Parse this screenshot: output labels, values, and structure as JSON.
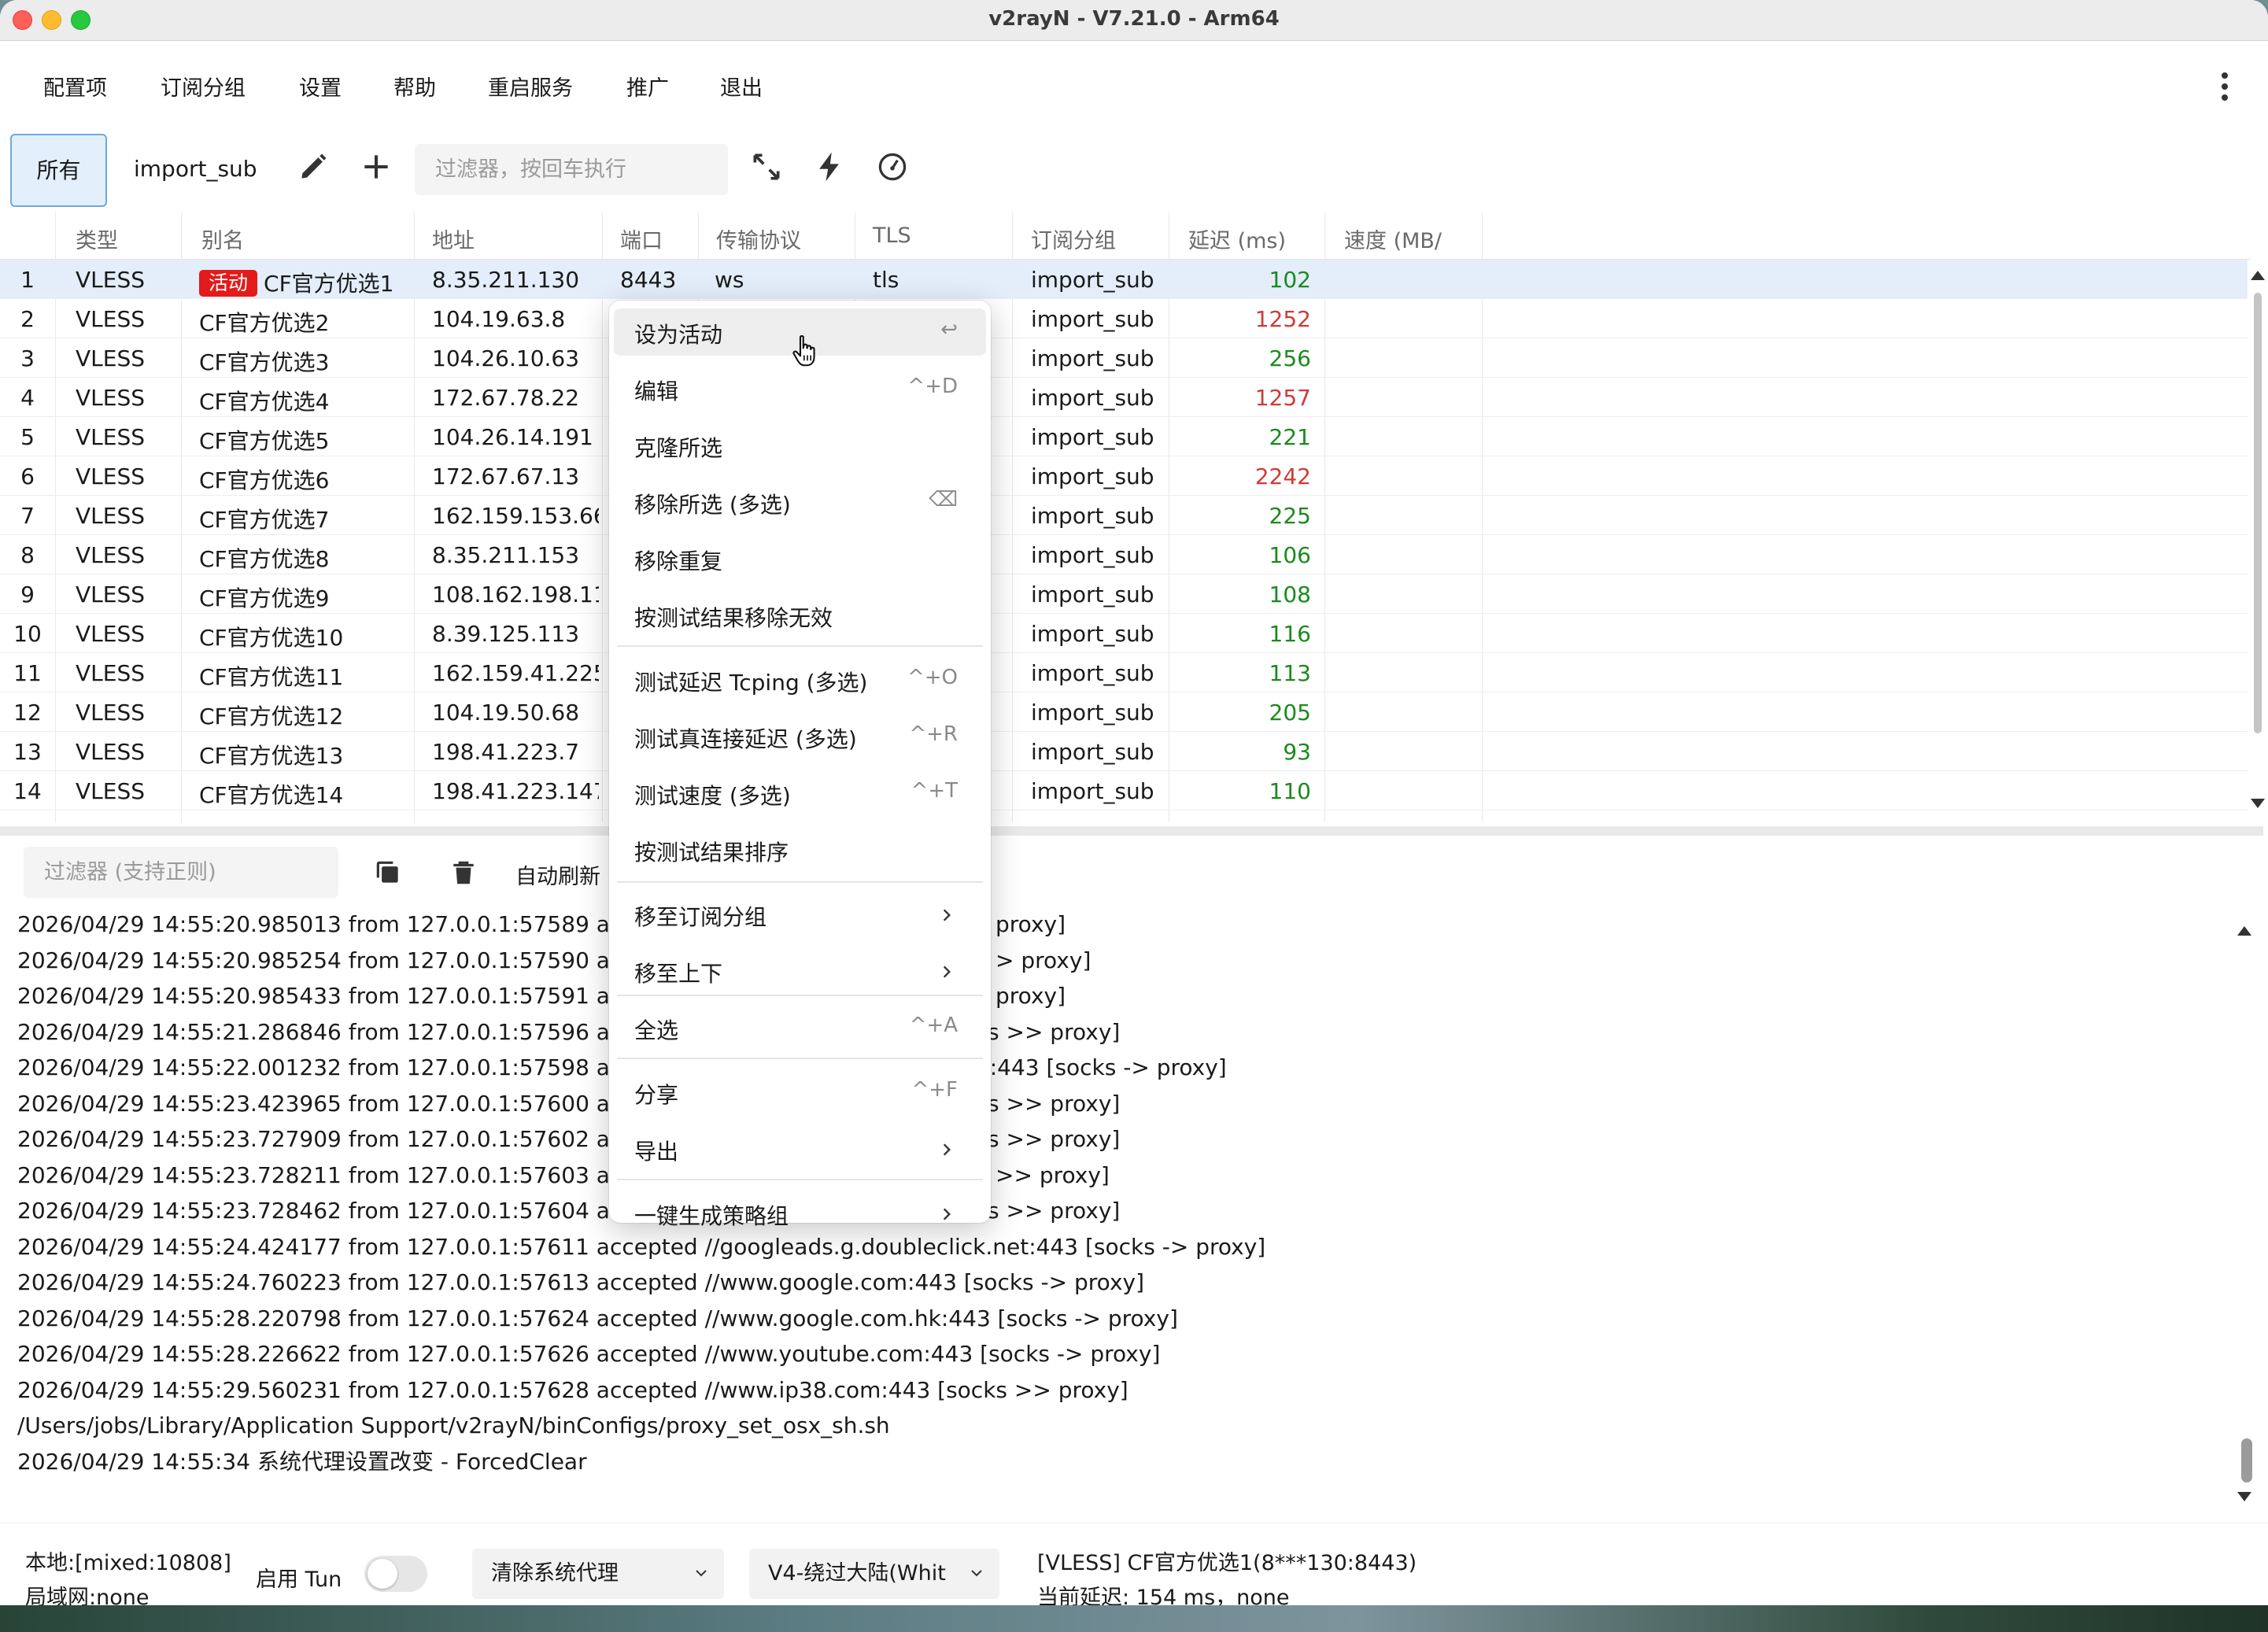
{
  "window": {
    "title": "v2rayN - V7.21.0 - Arm64"
  },
  "menu": {
    "items": [
      "配置项",
      "订阅分组",
      "设置",
      "帮助",
      "重启服务",
      "推广",
      "退出"
    ]
  },
  "toolbar": {
    "tab_all": "所有",
    "tab_sub": "import_sub",
    "filter_placeholder": "过滤器，按回车执行"
  },
  "table": {
    "headers": [
      "类型",
      "别名",
      "地址",
      "端口",
      "传输协议",
      "TLS",
      "订阅分组",
      "延迟 (ms)",
      "速度 (MB/"
    ],
    "active_badge": "活动",
    "rows": [
      {
        "idx": "1",
        "type": "VLESS",
        "alias": "CF官方优选1",
        "addr": "8.35.211.130",
        "port": "8443",
        "proto": "ws",
        "tls": "tls",
        "sub": "import_sub",
        "delay": "102",
        "status": "good"
      },
      {
        "idx": "2",
        "type": "VLESS",
        "alias": "CF官方优选2",
        "addr": "104.19.63.8",
        "port": "",
        "proto": "",
        "tls": "",
        "sub": "import_sub",
        "delay": "1252",
        "status": "bad"
      },
      {
        "idx": "3",
        "type": "VLESS",
        "alias": "CF官方优选3",
        "addr": "104.26.10.63",
        "port": "",
        "proto": "",
        "tls": "",
        "sub": "import_sub",
        "delay": "256",
        "status": "good"
      },
      {
        "idx": "4",
        "type": "VLESS",
        "alias": "CF官方优选4",
        "addr": "172.67.78.22",
        "port": "",
        "proto": "",
        "tls": "",
        "sub": "import_sub",
        "delay": "1257",
        "status": "bad"
      },
      {
        "idx": "5",
        "type": "VLESS",
        "alias": "CF官方优选5",
        "addr": "104.26.14.191",
        "port": "",
        "proto": "",
        "tls": "",
        "sub": "import_sub",
        "delay": "221",
        "status": "good"
      },
      {
        "idx": "6",
        "type": "VLESS",
        "alias": "CF官方优选6",
        "addr": "172.67.67.13",
        "port": "",
        "proto": "",
        "tls": "",
        "sub": "import_sub",
        "delay": "2242",
        "status": "bad"
      },
      {
        "idx": "7",
        "type": "VLESS",
        "alias": "CF官方优选7",
        "addr": "162.159.153.66",
        "port": "",
        "proto": "",
        "tls": "",
        "sub": "import_sub",
        "delay": "225",
        "status": "good"
      },
      {
        "idx": "8",
        "type": "VLESS",
        "alias": "CF官方优选8",
        "addr": "8.35.211.153",
        "port": "",
        "proto": "",
        "tls": "",
        "sub": "import_sub",
        "delay": "106",
        "status": "good"
      },
      {
        "idx": "9",
        "type": "VLESS",
        "alias": "CF官方优选9",
        "addr": "108.162.198.116",
        "port": "",
        "proto": "",
        "tls": "",
        "sub": "import_sub",
        "delay": "108",
        "status": "good"
      },
      {
        "idx": "10",
        "type": "VLESS",
        "alias": "CF官方优选10",
        "addr": "8.39.125.113",
        "port": "",
        "proto": "",
        "tls": "",
        "sub": "import_sub",
        "delay": "116",
        "status": "good"
      },
      {
        "idx": "11",
        "type": "VLESS",
        "alias": "CF官方优选11",
        "addr": "162.159.41.225",
        "port": "",
        "proto": "",
        "tls": "",
        "sub": "import_sub",
        "delay": "113",
        "status": "good"
      },
      {
        "idx": "12",
        "type": "VLESS",
        "alias": "CF官方优选12",
        "addr": "104.19.50.68",
        "port": "",
        "proto": "",
        "tls": "",
        "sub": "import_sub",
        "delay": "205",
        "status": "good"
      },
      {
        "idx": "13",
        "type": "VLESS",
        "alias": "CF官方优选13",
        "addr": "198.41.223.7",
        "port": "",
        "proto": "",
        "tls": "",
        "sub": "import_sub",
        "delay": "93",
        "status": "good"
      },
      {
        "idx": "14",
        "type": "VLESS",
        "alias": "CF官方优选14",
        "addr": "198.41.223.147",
        "port": "",
        "proto": "",
        "tls": "",
        "sub": "import_sub",
        "delay": "110",
        "status": "good"
      }
    ]
  },
  "context_menu": {
    "items": [
      {
        "label": "设为活动",
        "shortcut": "↩",
        "submenu": false
      },
      {
        "label": "编辑",
        "shortcut": "^+D",
        "submenu": false
      },
      {
        "label": "克隆所选",
        "shortcut": "",
        "submenu": false
      },
      {
        "label": "移除所选 (多选)",
        "shortcut": "⌫",
        "submenu": false
      },
      {
        "label": "移除重复",
        "shortcut": "",
        "submenu": false
      },
      {
        "label": "按测试结果移除无效",
        "shortcut": "",
        "submenu": false
      },
      {
        "label": "测试延迟 Tcping (多选)",
        "shortcut": "^+O",
        "submenu": false
      },
      {
        "label": "测试真连接延迟 (多选)",
        "shortcut": "^+R",
        "submenu": false
      },
      {
        "label": "测试速度 (多选)",
        "shortcut": "^+T",
        "submenu": false
      },
      {
        "label": "按测试结果排序",
        "shortcut": "",
        "submenu": false
      },
      {
        "label": "移至订阅分组",
        "shortcut": "",
        "submenu": true
      },
      {
        "label": "移至上下",
        "shortcut": "",
        "submenu": true
      },
      {
        "label": "全选",
        "shortcut": "^+A",
        "submenu": false
      },
      {
        "label": "分享",
        "shortcut": "^+F",
        "submenu": false
      },
      {
        "label": "导出",
        "shortcut": "",
        "submenu": true
      },
      {
        "label": "一键生成策略组",
        "shortcut": "",
        "submenu": true
      }
    ]
  },
  "log": {
    "filter_placeholder": "过滤器 (支持正则)",
    "auto_refresh": "自动刷新",
    "lines": [
      "2026/04/29 14:55:20.985013 from 127.0.0.1:57589 accep",
      "2026/04/29 14:55:20.985254 from 127.0.0.1:57590 accep",
      "2026/04/29 14:55:20.985433 from 127.0.0.1:57591 accep",
      "2026/04/29 14:55:21.286846 from 127.0.0.1:57596 accep",
      "2026/04/29 14:55:22.001232 from 127.0.0.1:57598 accep",
      "2026/04/29 14:55:23.423965 from 127.0.0.1:57600 accep",
      "2026/04/29 14:55:23.727909 from 127.0.0.1:57602 accep",
      "2026/04/29 14:55:23.728211 from 127.0.0.1:57603 accept",
      "2026/04/29 14:55:23.728462 from 127.0.0.1:57604 accep",
      "2026/04/29 14:55:24.424177 from 127.0.0.1:57611 accepted //googleads.g.doubleclick.net:443 [socks -> proxy]",
      "2026/04/29 14:55:24.760223 from 127.0.0.1:57613 accepted //www.google.com:443 [socks -> proxy]",
      "2026/04/29 14:55:28.220798 from 127.0.0.1:57624 accepted //www.google.com.hk:443 [socks -> proxy]",
      "2026/04/29 14:55:28.226622 from 127.0.0.1:57626 accepted //www.youtube.com:443 [socks -> proxy]",
      "2026/04/29 14:55:29.560231 from 127.0.0.1:57628 accepted //www.ip38.com:443 [socks >> proxy]",
      "/Users/jobs/Library/Application Support/v2rayN/binConfigs/proxy_set_osx_sh.sh",
      "2026/04/29 14:55:34 系统代理设置改变 - ForcedClear"
    ],
    "right_fragments": [
      "proxy]",
      "> proxy]",
      "proxy]",
      "s >> proxy]",
      "n:443 [socks -> proxy]",
      "s >> proxy]",
      "s >> proxy]",
      ">> proxy]",
      "s >> proxy]"
    ]
  },
  "statusbar": {
    "local": "本地:[mixed:10808]",
    "lan": "局域网:none",
    "tun_label": "启用 Tun",
    "proxy_mode": "清除系统代理",
    "routing": "V4-绕过大陆(Whit",
    "server": "[VLESS] CF官方优选1(8***130:8443)",
    "latency": "当前延迟: 154 ms，none"
  },
  "colors": {
    "accent": "#6fa8de",
    "delay_good": "#1c8a1c",
    "delay_bad": "#d03a3a",
    "badge": "#e31b1b"
  }
}
